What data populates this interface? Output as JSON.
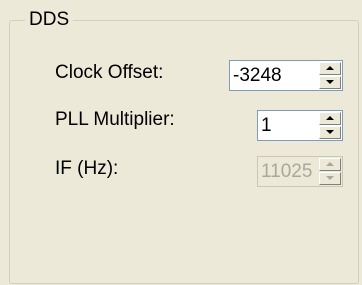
{
  "group": {
    "title": "DDS"
  },
  "fields": {
    "clock_offset": {
      "label": "Clock Offset:",
      "value": "-3248"
    },
    "pll_multiplier": {
      "label": "PLL Multiplier:",
      "value": "1"
    },
    "if_hz": {
      "label": "IF (Hz):",
      "value": "11025",
      "disabled": true
    }
  },
  "icons": {
    "spin_up": "arrow-up-icon",
    "spin_down": "arrow-down-icon"
  },
  "colors": {
    "background": "#ECE9D8",
    "field_border": "#7F9DB9",
    "disabled_text": "#ACA899"
  }
}
